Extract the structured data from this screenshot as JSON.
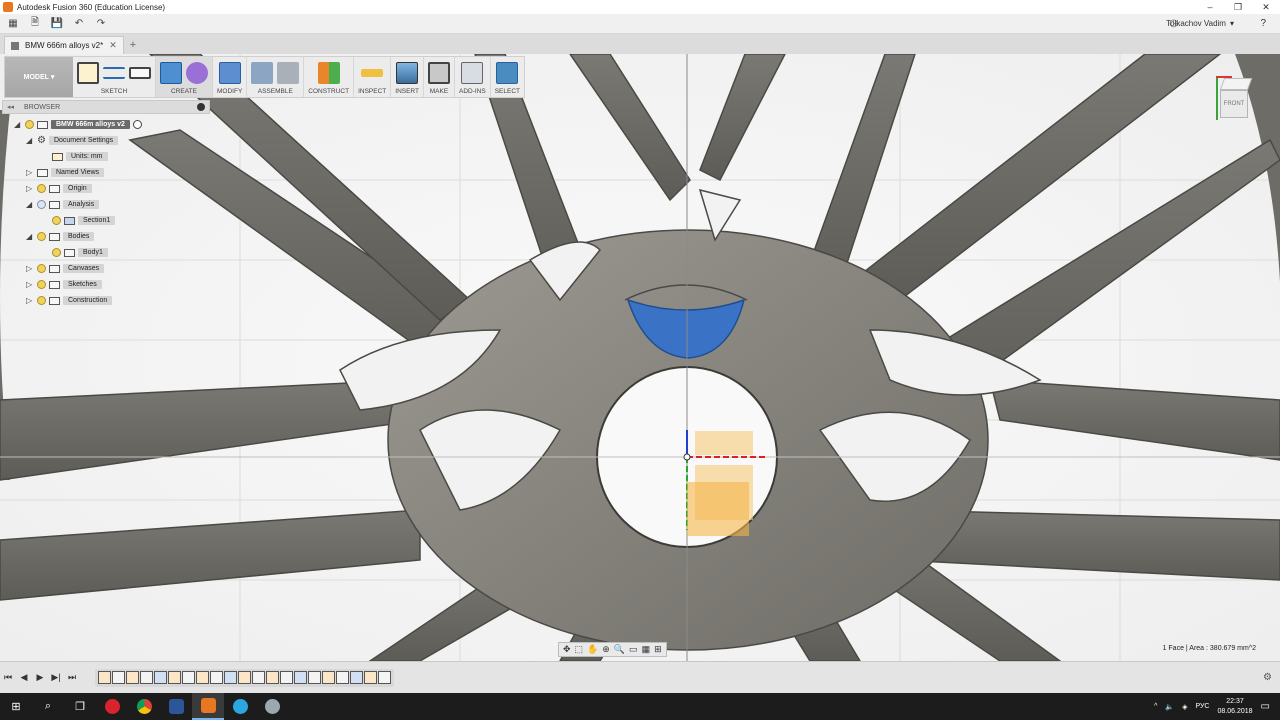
{
  "window": {
    "title": "Autodesk Fusion 360 (Education License)"
  },
  "qat": {
    "user": "Tolkachov Vadim",
    "help": "?"
  },
  "tab": {
    "label": "BMW 666m alloys v2*"
  },
  "ribbon": {
    "workspace": "MODEL",
    "groups": [
      "SKETCH",
      "CREATE",
      "MODIFY",
      "ASSEMBLE",
      "CONSTRUCT",
      "INSPECT",
      "INSERT",
      "MAKE",
      "ADD-INS",
      "SELECT"
    ]
  },
  "browser": {
    "header": "BROWSER",
    "nodes": [
      {
        "label": "BMW 666m alloys v2"
      },
      {
        "label": "Document Settings"
      },
      {
        "label": "Units: mm"
      },
      {
        "label": "Named Views"
      },
      {
        "label": "Origin"
      },
      {
        "label": "Analysis"
      },
      {
        "label": "Section1"
      },
      {
        "label": "Bodies"
      },
      {
        "label": "Body1"
      },
      {
        "label": "Canvases"
      },
      {
        "label": "Sketches"
      },
      {
        "label": "Construction"
      }
    ]
  },
  "viewcube": {
    "face": "FRONT"
  },
  "status": {
    "text": "1 Face | Area : 380.679 mm^2"
  },
  "taskbar": {
    "lang": "РУС",
    "time": "22:37",
    "date": "08.06.2018"
  },
  "colors": {
    "selected_face": "#3a73c6",
    "workspace_bg": "#a9a9a9",
    "select_accent": "#4a8cc0"
  },
  "icons": [
    "grid-menu-icon",
    "file-icon",
    "save-icon",
    "undo-icon",
    "redo-icon",
    "clock-icon",
    "help-icon",
    "close-icon",
    "plus-icon",
    "gear-icon",
    "bulb-icon",
    "folder-icon",
    "play-icon",
    "windows-start-icon",
    "search-icon",
    "task-view-icon",
    "opera-icon",
    "chrome-icon",
    "word-icon",
    "fusion-icon",
    "telegram-icon",
    "app-icon"
  ]
}
